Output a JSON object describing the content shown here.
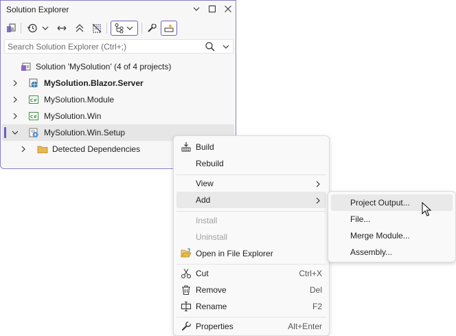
{
  "window": {
    "title": "Solution Explorer",
    "controls": [
      "chevron-down-icon",
      "maximize-icon",
      "close-icon"
    ]
  },
  "toolbar": {
    "tools": [
      "switch-views-icon",
      "history-icon",
      "chevron-down-icon",
      "sync-with-document-icon",
      "collapse-all-icon",
      "show-all-files-icon",
      "view-filter-icon",
      "chevron-down-icon",
      "properties-wrench-icon",
      "preview-selected-icon"
    ]
  },
  "search": {
    "placeholder": "Search Solution Explorer (Ctrl+;)"
  },
  "tree": {
    "solution": "Solution 'MySolution' (4 of 4 projects)",
    "projects": [
      {
        "label": "MySolution.Blazor.Server",
        "bold": true,
        "expanded": false,
        "icon": "web-project-icon"
      },
      {
        "label": "MySolution.Module",
        "bold": false,
        "expanded": false,
        "icon": "csharp-project-icon"
      },
      {
        "label": "MySolution.Win",
        "bold": false,
        "expanded": false,
        "icon": "csharp-project-icon"
      },
      {
        "label": "MySolution.Win.Setup",
        "bold": false,
        "expanded": true,
        "selected": true,
        "icon": "setup-project-icon"
      }
    ],
    "child": "Detected Dependencies"
  },
  "context_menu": {
    "items": [
      {
        "label": "Build",
        "icon": "build-icon",
        "shortcut": ""
      },
      {
        "label": "Rebuild",
        "icon": "",
        "shortcut": ""
      },
      {
        "label": "View",
        "icon": "",
        "shortcut": "",
        "submenu": true
      },
      {
        "label": "Add",
        "icon": "",
        "shortcut": "",
        "submenu": true,
        "highlighted": true
      },
      {
        "label": "Install",
        "icon": "",
        "shortcut": "",
        "disabled": true
      },
      {
        "label": "Uninstall",
        "icon": "",
        "shortcut": "",
        "disabled": true
      },
      {
        "label": "Open in File Explorer",
        "icon": "open-folder-icon",
        "shortcut": ""
      },
      {
        "label": "Cut",
        "icon": "scissors-icon",
        "shortcut": "Ctrl+X"
      },
      {
        "label": "Remove",
        "icon": "trash-icon",
        "shortcut": "Del"
      },
      {
        "label": "Rename",
        "icon": "rename-icon",
        "shortcut": "F2"
      },
      {
        "label": "Properties",
        "icon": "wrench-icon",
        "shortcut": "Alt+Enter"
      }
    ]
  },
  "add_submenu": {
    "items": [
      {
        "label": "Project Output...",
        "highlighted": true
      },
      {
        "label": "File..."
      },
      {
        "label": "Merge Module..."
      },
      {
        "label": "Assembly..."
      }
    ]
  },
  "colors": {
    "accent": "#6b5fb5",
    "window_border": "#8a7dc8",
    "selection": "#e6e6e6",
    "menu_bg": "#f9f9f9",
    "menu_hover": "#e9e9e9"
  }
}
